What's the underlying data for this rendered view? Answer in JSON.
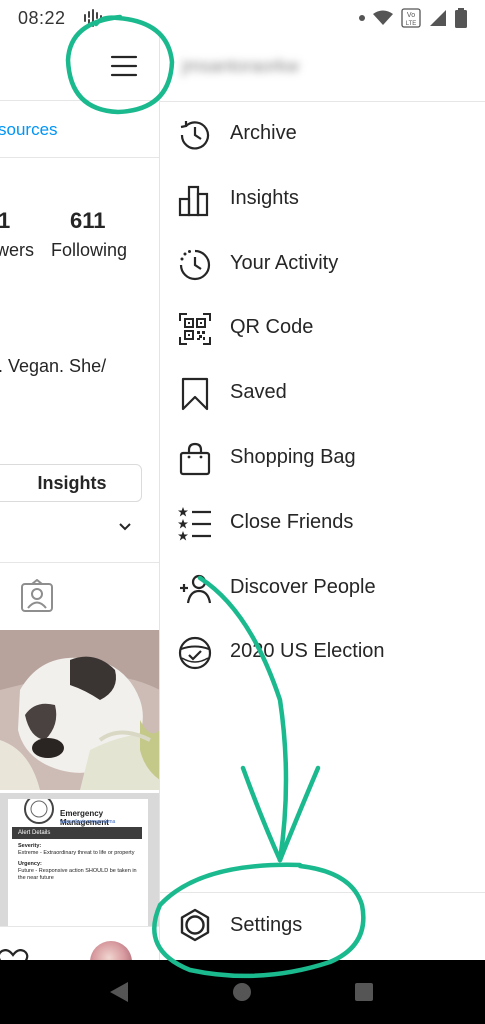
{
  "status_bar": {
    "time": "08:22",
    "icons": [
      "podcast-icon",
      "notification-dot-icon",
      "wifi-icon",
      "volte-icon",
      "signal-icon",
      "battery-icon"
    ],
    "volte_label_top": "Vo",
    "volte_label_bottom": "LTE"
  },
  "profile": {
    "resources_link": "sources",
    "followers_count": "1",
    "followers_label": "wers",
    "following_count": "611",
    "following_label": "Following",
    "bio": ". Vegan. She/",
    "insights_button": "Insights"
  },
  "alert_card": {
    "title_line1": "Emergency",
    "title_line2": "Management",
    "link": "www.stlouis-mo.gov/ema",
    "header": "Alert Details",
    "severity_label": "Severity:",
    "severity_text": "Extreme - Extraordinary threat to life or property",
    "urgency_label": "Urgency:",
    "urgency_text": "Future - Responsive action SHOULD be taken in the near future"
  },
  "drawer": {
    "items": [
      {
        "label": "Archive",
        "icon": "archive-icon"
      },
      {
        "label": "Insights",
        "icon": "insights-icon"
      },
      {
        "label": "Your Activity",
        "icon": "activity-icon"
      },
      {
        "label": "QR Code",
        "icon": "qr-code-icon"
      },
      {
        "label": "Saved",
        "icon": "bookmark-icon"
      },
      {
        "label": "Shopping Bag",
        "icon": "shopping-bag-icon"
      },
      {
        "label": "Close Friends",
        "icon": "close-friends-icon"
      },
      {
        "label": "Discover People",
        "icon": "add-person-icon"
      },
      {
        "label": "2020 US Election",
        "icon": "election-icon"
      }
    ],
    "settings_label": "Settings"
  },
  "colors": {
    "annotation": "#1bb98e",
    "link": "#0095f6",
    "text": "#262626"
  }
}
